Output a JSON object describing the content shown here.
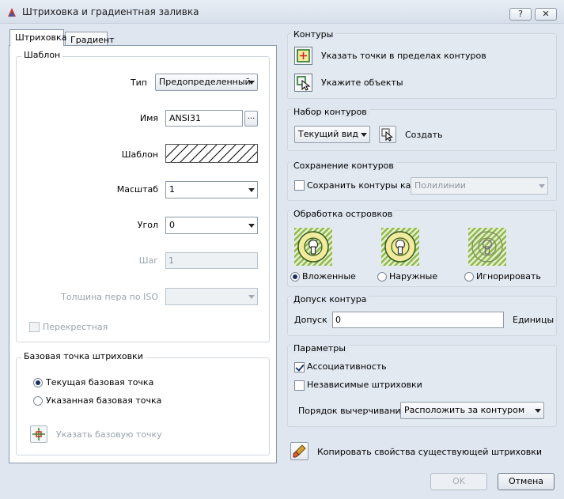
{
  "window": {
    "title": "Штриховка и градиентная заливка",
    "help_label": "?",
    "close_label": "✕"
  },
  "tabs": [
    {
      "label": "Штриховка"
    },
    {
      "label": "Градиент"
    }
  ],
  "pattern_group": {
    "title": "Шаблон",
    "type_label": "Тип",
    "type_value": "Предопределенный",
    "name_label": "Имя",
    "name_value": "ANSI31",
    "browse_label": "...",
    "swatch_label": "Шаблон",
    "scale_label": "Масштаб",
    "scale_value": "1",
    "angle_label": "Угол",
    "angle_value": "0",
    "spacing_label": "Шаг",
    "spacing_value": "1",
    "iso_label": "Толщина пера по ISO",
    "iso_value": "",
    "double_label": "Перекрестная"
  },
  "origin_group": {
    "title": "Базовая точка штриховки",
    "current_label": "Текущая базовая точка",
    "specified_label": "Указанная базовая точка",
    "pick_label": "Указать базовую точку"
  },
  "boundaries": {
    "title": "Контуры",
    "pick_points_label": "Указать точки в пределах контуров",
    "select_objects_label": "Укажите объекты"
  },
  "boundary_set": {
    "title": "Набор контуров",
    "value": "Текущий вид",
    "new_label": "Создать"
  },
  "retain": {
    "title": "Сохранение контуров",
    "checkbox_label": "Сохранить контуры как",
    "value": "Полилинии"
  },
  "islands": {
    "title": "Обработка островков",
    "options": [
      {
        "label": "Вложенные"
      },
      {
        "label": "Наружные"
      },
      {
        "label": "Игнорировать"
      }
    ]
  },
  "gap": {
    "title": "Допуск контура",
    "label": "Допуск",
    "value": "0",
    "unit": "Единицы"
  },
  "options": {
    "title": "Параметры",
    "associative_label": "Ассоциативность",
    "separate_label": "Независимые штриховки",
    "draw_order_label": "Порядок вычерчивания",
    "draw_order_value": "Расположить за контуром"
  },
  "inherit_label": "Копировать свойства существующей штриховки",
  "buttons": {
    "ok": "OK",
    "cancel": "Отмена"
  },
  "colors": {
    "dialog_bg": "#dfe6ef",
    "hatch_green": "#8fba4a",
    "icon_yellow": "#f2ea9c"
  }
}
